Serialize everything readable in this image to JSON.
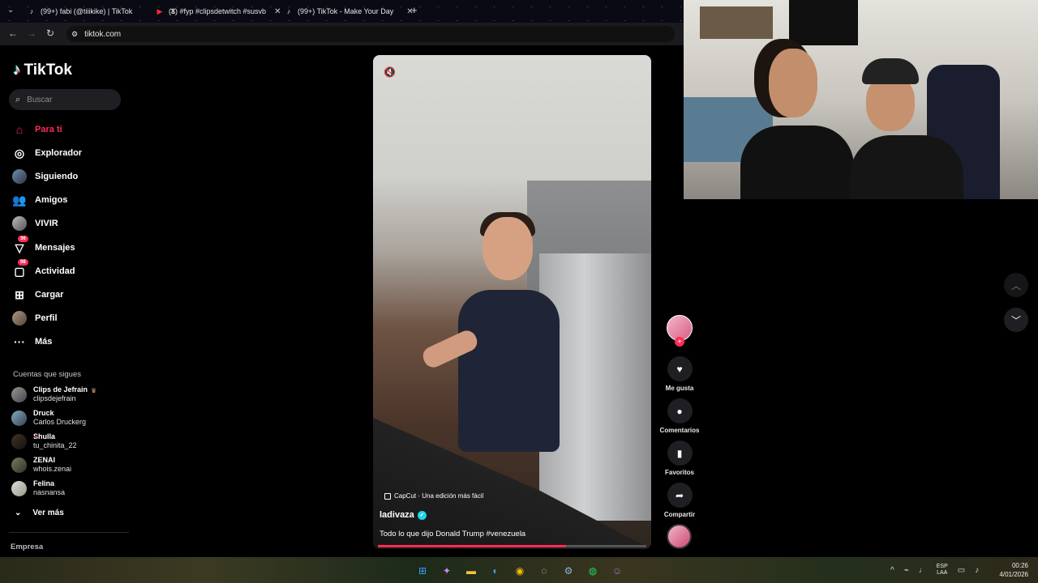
{
  "browser": {
    "tabs": [
      {
        "title": "(99+) fabi (@tiiikike) | TikTok",
        "icon": "tiktok-icon"
      },
      {
        "title": "(1) #fyp #clipsdetwitch #susvb",
        "icon": "youtube-icon"
      },
      {
        "title": "(99+) TikTok - Make Your Day",
        "icon": "tiktok-icon"
      }
    ],
    "url": "tiktok.com",
    "new_tab": "+"
  },
  "sidebar": {
    "logo": "TikTok",
    "search_placeholder": "Buscar",
    "nav": [
      {
        "label": "Para ti",
        "icon": "home-icon",
        "active": true
      },
      {
        "label": "Explorador",
        "icon": "compass-icon"
      },
      {
        "label": "Siguiendo",
        "icon": "following-avatar-icon"
      },
      {
        "label": "Amigos",
        "icon": "friends-icon"
      },
      {
        "label": "VIVIR",
        "icon": "live-icon"
      },
      {
        "label": "Mensajes",
        "icon": "messages-icon",
        "badge": "36"
      },
      {
        "label": "Actividad",
        "icon": "activity-icon",
        "badge": "98"
      },
      {
        "label": "Cargar",
        "icon": "upload-icon"
      },
      {
        "label": "Perfil",
        "icon": "profile-avatar-icon"
      },
      {
        "label": "Más",
        "icon": "more-icon"
      }
    ],
    "following_title": "Cuentas que sigues",
    "following": [
      {
        "name": "Clips de Jefrain",
        "handle": "clipsdejefrain"
      },
      {
        "name": "Druck",
        "handle": "Carlos Druckerg"
      },
      {
        "name": "Shulla",
        "handle": "tu_chinita_22"
      },
      {
        "name": "ZENAI",
        "handle": "whois.zenai"
      },
      {
        "name": "Felina",
        "handle": "nasnansa"
      }
    ],
    "see_more": "Ver más",
    "footer": "Empresa"
  },
  "video": {
    "capcut": "CapCut · Una edición más fácil",
    "author": "ladivaza",
    "description": "Todo lo que dijo Donald Trump #venezuela",
    "progress": 0.7
  },
  "actions": {
    "like": "Me gusta",
    "comments": "Comentarios",
    "favorites": "Favoritos",
    "share": "Compartir"
  },
  "taskbar": {
    "lang_top": "ESP",
    "lang_bottom": "LAA",
    "time": "00:26",
    "date": "4/01/2026"
  },
  "colors": {
    "accent": "#fe2c55",
    "verified": "#20d5ec"
  }
}
